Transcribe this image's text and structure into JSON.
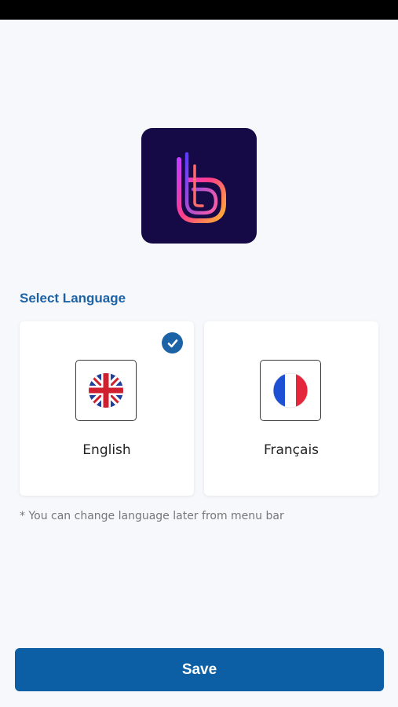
{
  "screen": {
    "section_title": "Select Language",
    "hint": "* You can change language later from menu bar",
    "save_label": "Save"
  },
  "languages": [
    {
      "label": "English",
      "flag_icon": "uk-flag-icon",
      "selected": true
    },
    {
      "label": "Français",
      "flag_icon": "france-flag-icon",
      "selected": false
    }
  ],
  "colors": {
    "accent": "#1b63a6",
    "button": "#0c5fa4",
    "logo_background": "#150a45",
    "page_background": "#f6f8fc"
  },
  "icons": {
    "logo": "app-logo-icon",
    "selected": "check-icon"
  }
}
